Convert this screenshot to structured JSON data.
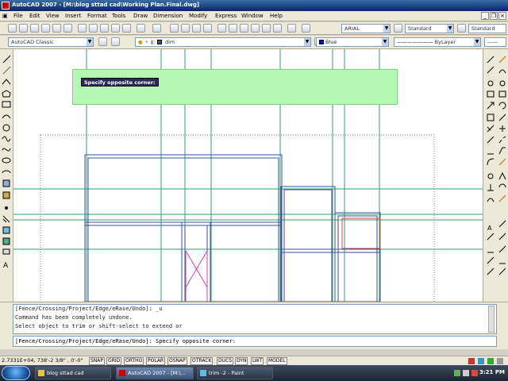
{
  "window": {
    "title": "AutoCAD 2007 - [M:\\blog sttad cad\\Working Plan.Final.dwg]"
  },
  "menu": [
    "File",
    "Edit",
    "View",
    "Insert",
    "Format",
    "Tools",
    "Draw",
    "Dimension",
    "Modify",
    "Express",
    "Window",
    "Help"
  ],
  "toolbar": {
    "text_style": "ARIAL",
    "dim_style": "Standard",
    "table_style": "Standard",
    "workspace": "AutoCAD Classic",
    "layer": "dim",
    "color": "Blue",
    "linetype": "ByLayer"
  },
  "tooltip": {
    "text": "Specify opposite corner:"
  },
  "command": {
    "history": [
      "[Fence/Crossing/Project/Edge/eRase/Undo]: _u",
      "Command has been completely undone.",
      "Select object to trim or shift-select to extend or"
    ],
    "input": "[Fence/Crossing/Project/Edge/eRase/Undo]: Specify opposite corner:"
  },
  "status": {
    "coords": "2.7331E+04,  738'-2 3/8\" , 0'-0\"",
    "buttons": [
      "SNAP",
      "GRID",
      "ORTHO",
      "POLAR",
      "OSNAP",
      "OTRACK",
      "DUCS",
      "DYN",
      "LWT",
      "MODEL"
    ]
  },
  "taskbar": {
    "tasks": [
      {
        "label": "blog sttad cad"
      },
      {
        "label": "AutoCAD 2007 - [M:\\..."
      },
      {
        "label": "trim -2 - Paint"
      }
    ],
    "clock": "3:21 PM"
  },
  "colors": {
    "drawing_blue": "#3a4fa0",
    "drawing_green": "#2fa36b",
    "drawing_red": "#d04040",
    "drawing_magenta": "#d040c0",
    "selection_window": "#b6f7b6",
    "tooltip_bg": "#2a2a5a"
  }
}
